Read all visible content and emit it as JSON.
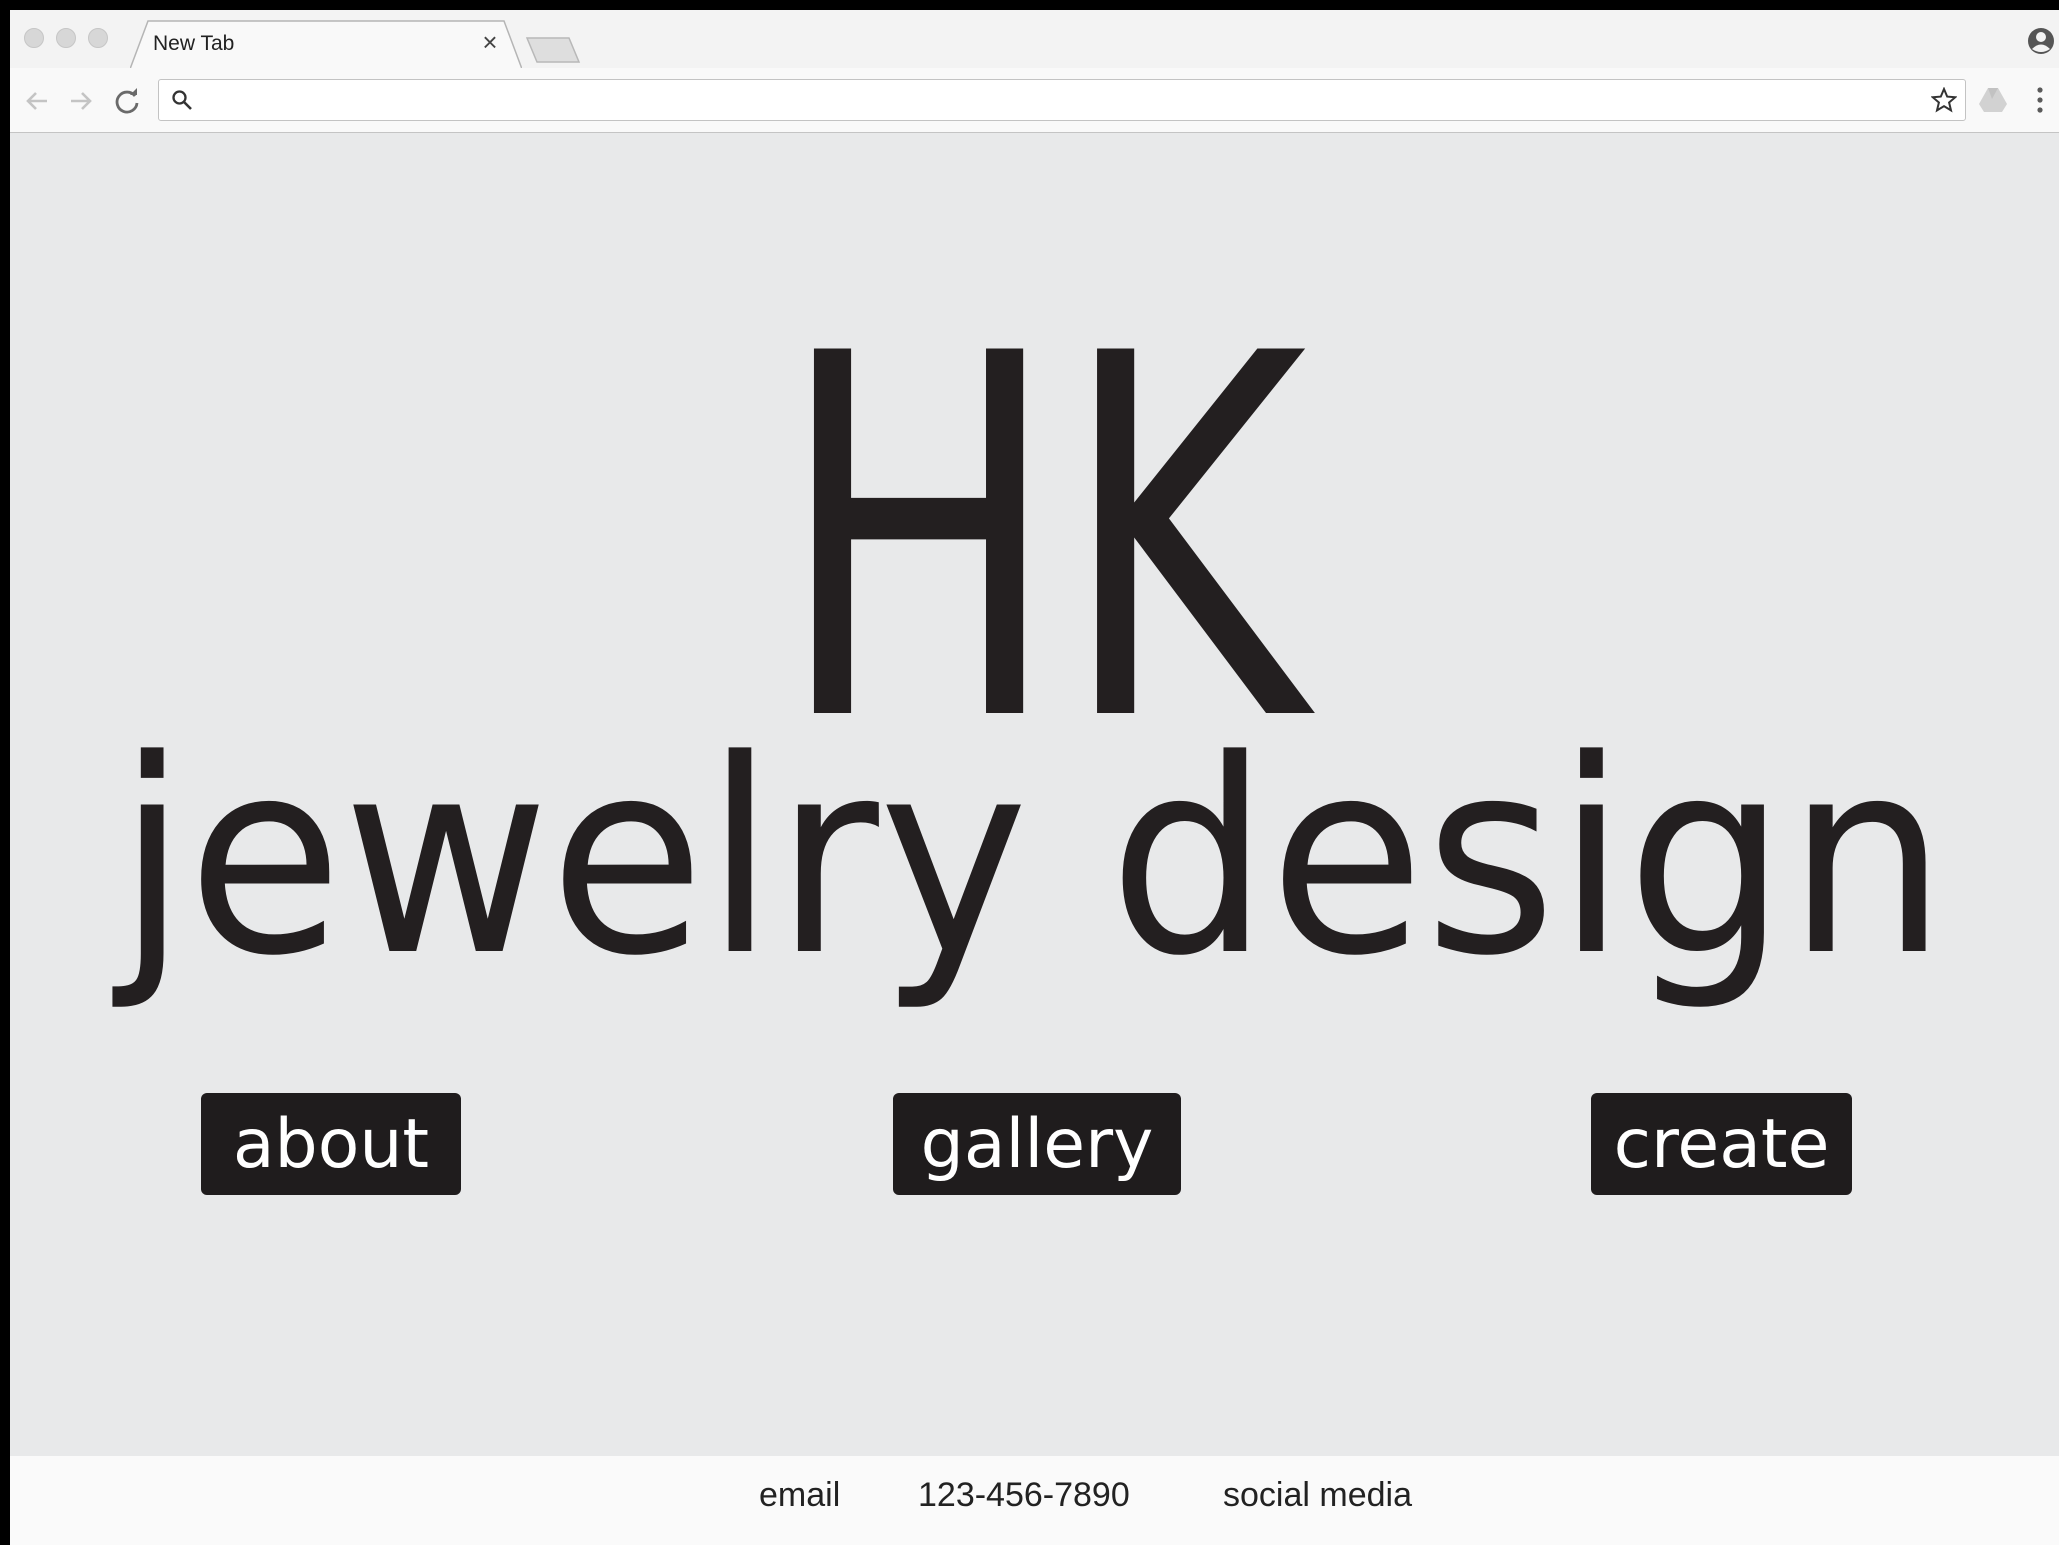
{
  "browser": {
    "tab_title": "New Tab",
    "tab_close_glyph": "×",
    "omnibox": {
      "value": "",
      "placeholder": ""
    },
    "icons": {
      "back": "arrow-left-icon",
      "forward": "arrow-right-icon",
      "reload": "reload-icon",
      "search": "search-icon",
      "bookmark": "star-icon",
      "extension": "drive-icon",
      "menu": "vertical-dots-icon",
      "profile": "person-icon"
    }
  },
  "site": {
    "logo_initials": "HK",
    "logo_tagline": "jewelry design",
    "nav": {
      "about_label": "about",
      "gallery_label": "gallery",
      "create_label": "create"
    },
    "footer": {
      "email_label": "email",
      "phone_label": "123-456-7890",
      "social_label": "social media"
    }
  },
  "colors": {
    "page_background": "#e8e9ea",
    "button_background": "#1f1c1d",
    "button_text": "#ffffff",
    "logo_text": "#231f20",
    "footer_background": "#fafafa"
  }
}
